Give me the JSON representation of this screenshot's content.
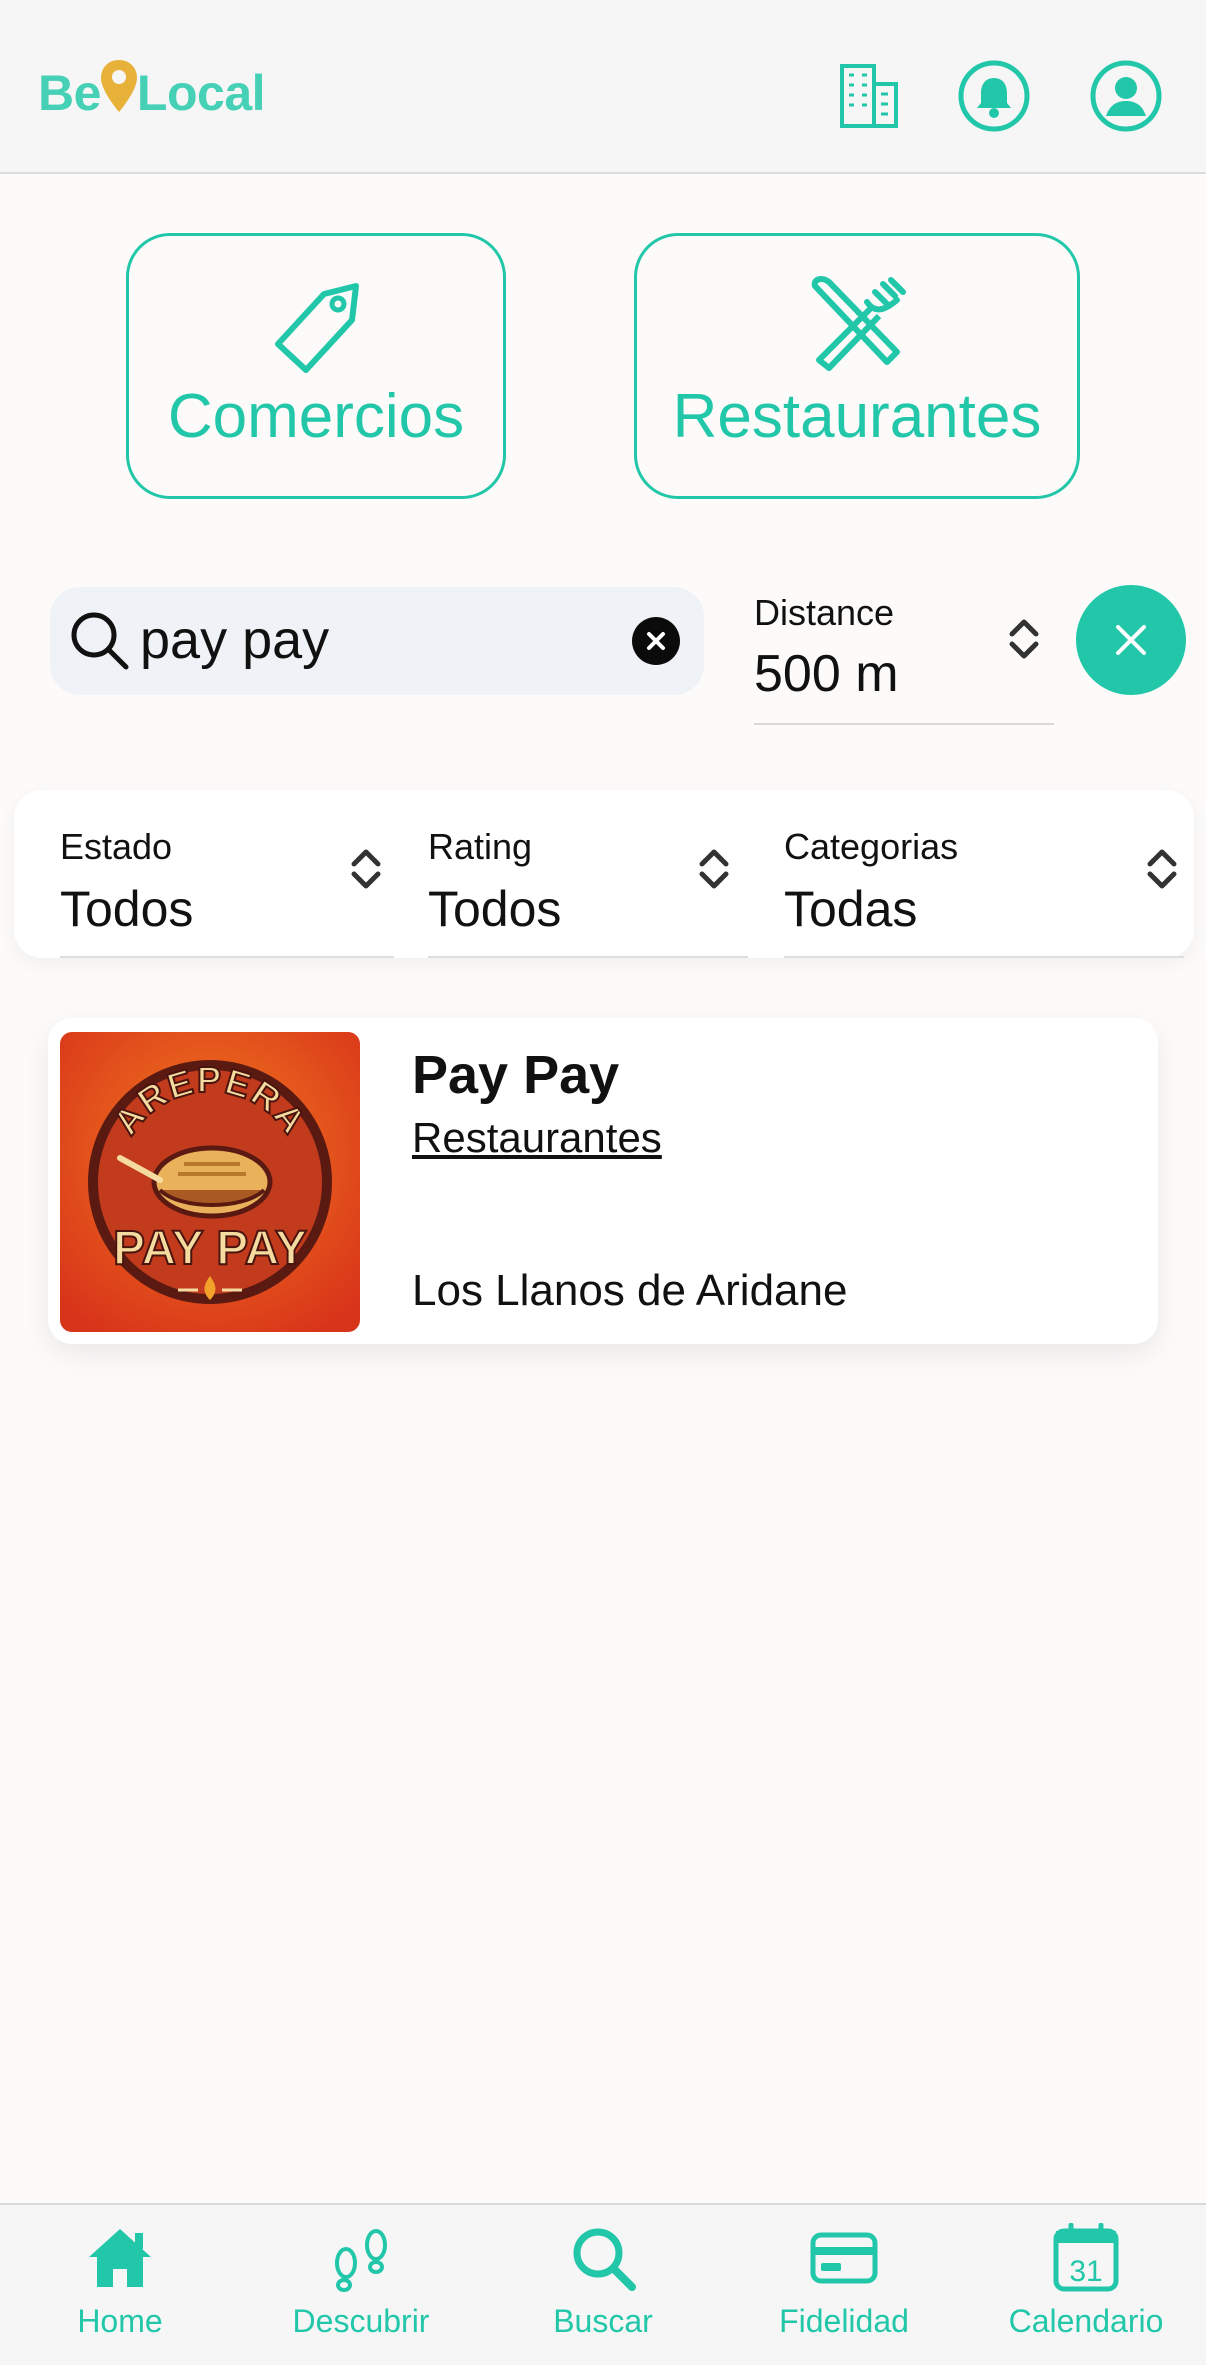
{
  "app": {
    "logo_left": "Be",
    "logo_right": "Local",
    "colors": {
      "accent": "#22c7a9",
      "pin": "#e8b23a",
      "thumb_bg": "#e44d15"
    }
  },
  "header": {
    "icons": [
      "building-icon",
      "bell-icon",
      "profile-icon"
    ]
  },
  "categories": [
    {
      "label": "Comercios",
      "icon": "tag-icon"
    },
    {
      "label": "Restaurantes",
      "icon": "fork-knife-icon"
    }
  ],
  "search": {
    "value": "pay pay",
    "placeholder": ""
  },
  "distance": {
    "label": "Distance",
    "value": "500 m"
  },
  "filters": [
    {
      "label": "Estado",
      "value": "Todos"
    },
    {
      "label": "Rating",
      "value": "Todos"
    },
    {
      "label": "Categorias",
      "value": "Todas"
    }
  ],
  "results": [
    {
      "name": "Pay Pay",
      "category": "Restaurantes",
      "location": "Los Llanos de Aridane",
      "logo_text_top": "AREPERA",
      "logo_text_bottom": "PAY PAY"
    }
  ],
  "bottom_nav": [
    {
      "label": "Home",
      "icon": "home-icon"
    },
    {
      "label": "Descubrir",
      "icon": "footprints-icon"
    },
    {
      "label": "Buscar",
      "icon": "search-icon"
    },
    {
      "label": "Fidelidad",
      "icon": "card-icon"
    },
    {
      "label": "Calendario",
      "icon": "calendar-icon",
      "day": "31"
    }
  ]
}
